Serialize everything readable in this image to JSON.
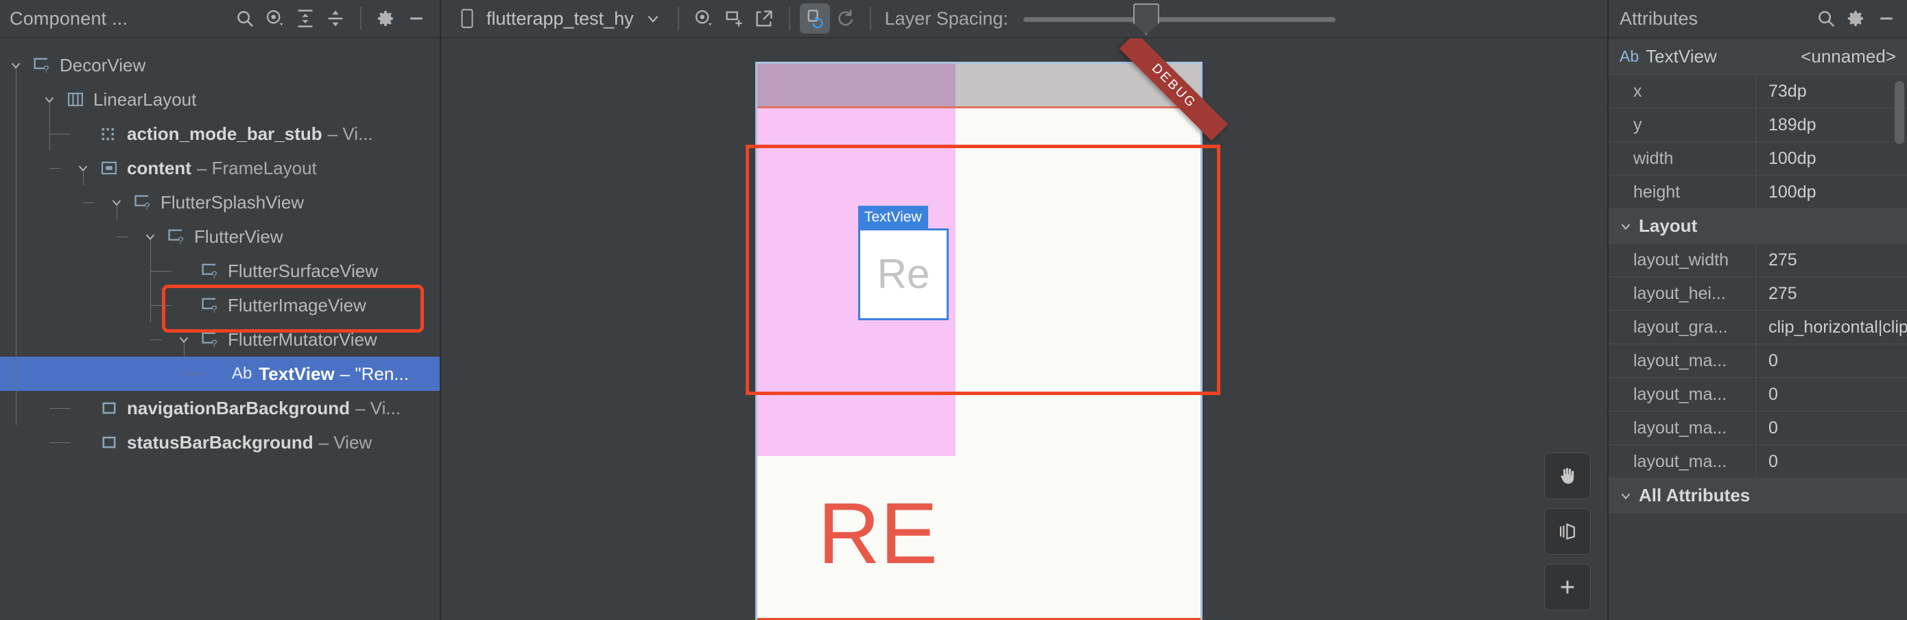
{
  "tree_panel": {
    "title": "Component ...",
    "toolbar_icons": [
      "search-icon",
      "eye-dropdown-icon",
      "expand-all-icon",
      "collapse-all-icon",
      "gear-icon",
      "minimize-icon"
    ],
    "nodes": [
      {
        "depth": 0,
        "chevron": "down",
        "icon": "view-unknown-icon",
        "name": "DecorView",
        "type": "",
        "bold": false,
        "selected": false
      },
      {
        "depth": 1,
        "chevron": "down",
        "icon": "linear-layout-icon",
        "name": "LinearLayout",
        "type": "",
        "bold": false,
        "selected": false
      },
      {
        "depth": 2,
        "chevron": "none",
        "icon": "view-stub-icon",
        "name": "action_mode_bar_stub",
        "type": "– Vi...",
        "bold": true,
        "selected": false
      },
      {
        "depth": 2,
        "chevron": "down",
        "icon": "frame-layout-icon",
        "name": "content",
        "type": "– FrameLayout",
        "bold": true,
        "selected": false
      },
      {
        "depth": 3,
        "chevron": "down",
        "icon": "view-unknown-icon",
        "name": "FlutterSplashView",
        "type": "",
        "bold": false,
        "selected": false
      },
      {
        "depth": 4,
        "chevron": "down",
        "icon": "view-unknown-icon",
        "name": "FlutterView",
        "type": "",
        "bold": false,
        "selected": false
      },
      {
        "depth": 5,
        "chevron": "none",
        "icon": "view-unknown-icon",
        "name": "FlutterSurfaceView",
        "type": "",
        "bold": false,
        "selected": false
      },
      {
        "depth": 5,
        "chevron": "none",
        "icon": "view-unknown-icon",
        "name": "FlutterImageView",
        "type": "",
        "bold": false,
        "selected": false,
        "highlighted": true
      },
      {
        "depth": 5,
        "chevron": "down",
        "icon": "view-unknown-icon",
        "name": "FlutterMutatorView",
        "type": "",
        "bold": false,
        "selected": false
      },
      {
        "depth": 6,
        "chevron": "none",
        "icon": "ab-text-icon",
        "name": "TextView",
        "type": "– \"Ren...",
        "bold": true,
        "selected": true
      },
      {
        "depth": 2,
        "chevron": "none",
        "icon": "view-box-icon",
        "name": "navigationBarBackground",
        "type": "– Vi...",
        "bold": true,
        "selected": false
      },
      {
        "depth": 2,
        "chevron": "none",
        "icon": "view-box-icon",
        "name": "statusBarBackground",
        "type": "– View",
        "bold": true,
        "selected": false
      }
    ]
  },
  "center_toolbar": {
    "device_icon": "phone-icon",
    "device_name": "flutterapp_test_hy",
    "device_dropdown_icon": "chevron-down-icon",
    "icons": [
      "eye-dropdown-icon",
      "add-snapshot-icon",
      "export-icon",
      "rotate-3d-icon",
      "refresh-icon"
    ],
    "layer_spacing_label": "Layer Spacing:",
    "slider_value_percent": 38
  },
  "canvas": {
    "debug_banner": "DEBUG",
    "textview_badge": "TextView",
    "textview_text": "Re",
    "big_text": "RE",
    "highlight_color": "#f04323",
    "status_bar_left_color": "#bd9dbe",
    "status_bar_right_color": "#c5c3c3",
    "content_left_color": "#f8c4f5",
    "device_bg_color": "#fafaf7",
    "float_tools": [
      "pan-hand-icon",
      "layer-rotate-icon",
      "add-icon"
    ]
  },
  "attributes_panel": {
    "title": "Attributes",
    "header_icons": [
      "search-icon",
      "gear-icon",
      "minimize-icon"
    ],
    "selected_element": {
      "icon": "ab-text-icon",
      "type": "TextView",
      "id": "<unnamed>"
    },
    "rows": [
      {
        "key": "x",
        "value": "73dp"
      },
      {
        "key": "y",
        "value": "189dp"
      },
      {
        "key": "width",
        "value": "100dp"
      },
      {
        "key": "height",
        "value": "100dp"
      }
    ],
    "layout_section": {
      "label": "Layout",
      "expanded": true,
      "rows": [
        {
          "key": "layout_width",
          "value": "275"
        },
        {
          "key": "layout_hei...",
          "value": "275"
        },
        {
          "key": "layout_gra...",
          "value": "clip_horizontal|clip,"
        },
        {
          "key": "layout_ma...",
          "value": "0"
        },
        {
          "key": "layout_ma...",
          "value": "0"
        },
        {
          "key": "layout_ma...",
          "value": "0"
        },
        {
          "key": "layout_ma...",
          "value": "0"
        }
      ]
    },
    "all_attributes_section": {
      "label": "All Attributes",
      "expanded": true
    }
  }
}
